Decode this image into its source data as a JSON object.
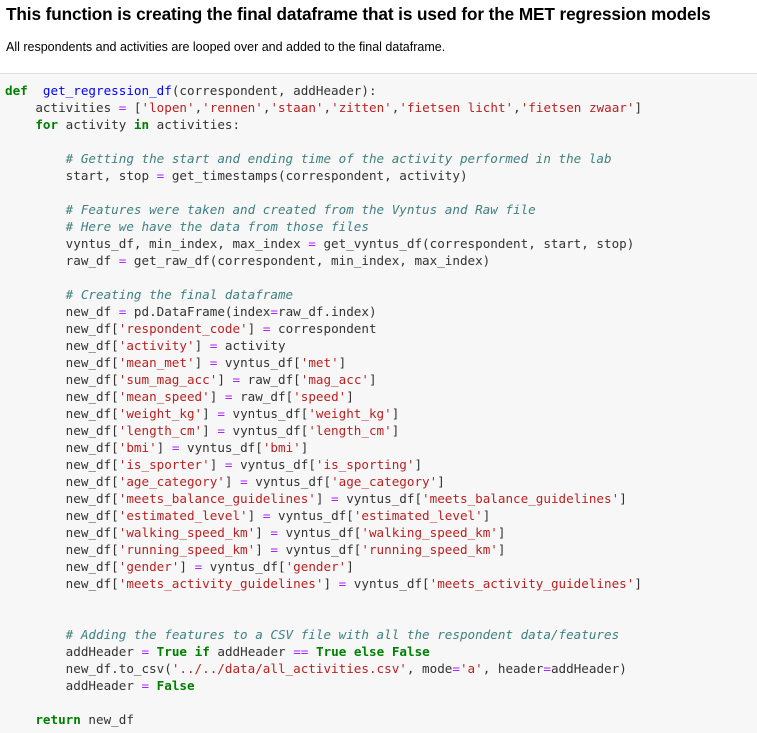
{
  "markdown": {
    "title": "This function is creating the final dataframe that is used for the MET regression models",
    "description": "All respondents and activities are looped over and added to the final dataframe."
  },
  "code_cell": {
    "lines": [
      [
        [
          "kw",
          "def"
        ],
        [
          "",
          "  "
        ],
        [
          "fn",
          "get_regression_df"
        ],
        [
          "",
          "(correspondent, addHeader):"
        ]
      ],
      [
        [
          "",
          "    activities "
        ],
        [
          "op",
          "="
        ],
        [
          "",
          " ["
        ],
        [
          "str",
          "'lopen'"
        ],
        [
          "",
          ","
        ],
        [
          "str",
          "'rennen'"
        ],
        [
          "",
          ","
        ],
        [
          "str",
          "'staan'"
        ],
        [
          "",
          ","
        ],
        [
          "str",
          "'zitten'"
        ],
        [
          "",
          ","
        ],
        [
          "str",
          "'fietsen licht'"
        ],
        [
          "",
          ","
        ],
        [
          "str",
          "'fietsen zwaar'"
        ],
        [
          "",
          "]"
        ]
      ],
      [
        [
          "",
          "    "
        ],
        [
          "kw",
          "for"
        ],
        [
          "",
          " activity "
        ],
        [
          "kw",
          "in"
        ],
        [
          "",
          " activities:"
        ]
      ],
      [
        [
          "",
          ""
        ]
      ],
      [
        [
          "",
          "        "
        ],
        [
          "cm",
          "# Getting the start and ending time of the activity performed in the lab"
        ]
      ],
      [
        [
          "",
          "        start, stop "
        ],
        [
          "op",
          "="
        ],
        [
          "",
          " get_timestamps(correspondent, activity)"
        ]
      ],
      [
        [
          "",
          ""
        ]
      ],
      [
        [
          "",
          "        "
        ],
        [
          "cm",
          "# Features were taken and created from the Vyntus and Raw file"
        ]
      ],
      [
        [
          "",
          "        "
        ],
        [
          "cm",
          "# Here we have the data from those files"
        ]
      ],
      [
        [
          "",
          "        vyntus_df, min_index, max_index "
        ],
        [
          "op",
          "="
        ],
        [
          "",
          " get_vyntus_df(correspondent, start, stop)"
        ]
      ],
      [
        [
          "",
          "        raw_df "
        ],
        [
          "op",
          "="
        ],
        [
          "",
          " get_raw_df(correspondent, min_index, max_index)"
        ]
      ],
      [
        [
          "",
          ""
        ]
      ],
      [
        [
          "",
          "        "
        ],
        [
          "cm",
          "# Creating the final dataframe"
        ]
      ],
      [
        [
          "",
          "        new_df "
        ],
        [
          "op",
          "="
        ],
        [
          "",
          " pd.DataFrame(index"
        ],
        [
          "op",
          "="
        ],
        [
          "",
          "raw_df.index)"
        ]
      ],
      [
        [
          "",
          "        new_df["
        ],
        [
          "str",
          "'respondent_code'"
        ],
        [
          "",
          "] "
        ],
        [
          "op",
          "="
        ],
        [
          "",
          " correspondent"
        ]
      ],
      [
        [
          "",
          "        new_df["
        ],
        [
          "str",
          "'activity'"
        ],
        [
          "",
          "] "
        ],
        [
          "op",
          "="
        ],
        [
          "",
          " activity"
        ]
      ],
      [
        [
          "",
          "        new_df["
        ],
        [
          "str",
          "'mean_met'"
        ],
        [
          "",
          "] "
        ],
        [
          "op",
          "="
        ],
        [
          "",
          " vyntus_df["
        ],
        [
          "str",
          "'met'"
        ],
        [
          "",
          "]"
        ]
      ],
      [
        [
          "",
          "        new_df["
        ],
        [
          "str",
          "'sum_mag_acc'"
        ],
        [
          "",
          "] "
        ],
        [
          "op",
          "="
        ],
        [
          "",
          " raw_df["
        ],
        [
          "str",
          "'mag_acc'"
        ],
        [
          "",
          "]"
        ]
      ],
      [
        [
          "",
          "        new_df["
        ],
        [
          "str",
          "'mean_speed'"
        ],
        [
          "",
          "] "
        ],
        [
          "op",
          "="
        ],
        [
          "",
          " raw_df["
        ],
        [
          "str",
          "'speed'"
        ],
        [
          "",
          "]"
        ]
      ],
      [
        [
          "",
          "        new_df["
        ],
        [
          "str",
          "'weight_kg'"
        ],
        [
          "",
          "] "
        ],
        [
          "op",
          "="
        ],
        [
          "",
          " vyntus_df["
        ],
        [
          "str",
          "'weight_kg'"
        ],
        [
          "",
          "]"
        ]
      ],
      [
        [
          "",
          "        new_df["
        ],
        [
          "str",
          "'length_cm'"
        ],
        [
          "",
          "] "
        ],
        [
          "op",
          "="
        ],
        [
          "",
          " vyntus_df["
        ],
        [
          "str",
          "'length_cm'"
        ],
        [
          "",
          "]"
        ]
      ],
      [
        [
          "",
          "        new_df["
        ],
        [
          "str",
          "'bmi'"
        ],
        [
          "",
          "] "
        ],
        [
          "op",
          "="
        ],
        [
          "",
          " vyntus_df["
        ],
        [
          "str",
          "'bmi'"
        ],
        [
          "",
          "]"
        ]
      ],
      [
        [
          "",
          "        new_df["
        ],
        [
          "str",
          "'is_sporter'"
        ],
        [
          "",
          "] "
        ],
        [
          "op",
          "="
        ],
        [
          "",
          " vyntus_df["
        ],
        [
          "str",
          "'is_sporting'"
        ],
        [
          "",
          "]"
        ]
      ],
      [
        [
          "",
          "        new_df["
        ],
        [
          "str",
          "'age_category'"
        ],
        [
          "",
          "] "
        ],
        [
          "op",
          "="
        ],
        [
          "",
          " vyntus_df["
        ],
        [
          "str",
          "'age_category'"
        ],
        [
          "",
          "]"
        ]
      ],
      [
        [
          "",
          "        new_df["
        ],
        [
          "str",
          "'meets_balance_guidelines'"
        ],
        [
          "",
          "] "
        ],
        [
          "op",
          "="
        ],
        [
          "",
          " vyntus_df["
        ],
        [
          "str",
          "'meets_balance_guidelines'"
        ],
        [
          "",
          "]"
        ]
      ],
      [
        [
          "",
          "        new_df["
        ],
        [
          "str",
          "'estimated_level'"
        ],
        [
          "",
          "] "
        ],
        [
          "op",
          "="
        ],
        [
          "",
          " vyntus_df["
        ],
        [
          "str",
          "'estimated_level'"
        ],
        [
          "",
          "]"
        ]
      ],
      [
        [
          "",
          "        new_df["
        ],
        [
          "str",
          "'walking_speed_km'"
        ],
        [
          "",
          "] "
        ],
        [
          "op",
          "="
        ],
        [
          "",
          " vyntus_df["
        ],
        [
          "str",
          "'walking_speed_km'"
        ],
        [
          "",
          "]"
        ]
      ],
      [
        [
          "",
          "        new_df["
        ],
        [
          "str",
          "'running_speed_km'"
        ],
        [
          "",
          "] "
        ],
        [
          "op",
          "="
        ],
        [
          "",
          " vyntus_df["
        ],
        [
          "str",
          "'running_speed_km'"
        ],
        [
          "",
          "]"
        ]
      ],
      [
        [
          "",
          "        new_df["
        ],
        [
          "str",
          "'gender'"
        ],
        [
          "",
          "] "
        ],
        [
          "op",
          "="
        ],
        [
          "",
          " vyntus_df["
        ],
        [
          "str",
          "'gender'"
        ],
        [
          "",
          "]"
        ]
      ],
      [
        [
          "",
          "        new_df["
        ],
        [
          "str",
          "'meets_activity_guidelines'"
        ],
        [
          "",
          "] "
        ],
        [
          "op",
          "="
        ],
        [
          "",
          " vyntus_df["
        ],
        [
          "str",
          "'meets_activity_guidelines'"
        ],
        [
          "",
          "]"
        ]
      ],
      [
        [
          "",
          ""
        ]
      ],
      [
        [
          "",
          ""
        ]
      ],
      [
        [
          "",
          "        "
        ],
        [
          "cm",
          "# Adding the features to a CSV file with all the respondent data/features"
        ]
      ],
      [
        [
          "",
          "        addHeader "
        ],
        [
          "op",
          "="
        ],
        [
          "",
          " "
        ],
        [
          "kw",
          "True"
        ],
        [
          "",
          " "
        ],
        [
          "kw",
          "if"
        ],
        [
          "",
          " addHeader "
        ],
        [
          "op",
          "=="
        ],
        [
          "",
          " "
        ],
        [
          "kw",
          "True"
        ],
        [
          "",
          " "
        ],
        [
          "kw",
          "else"
        ],
        [
          "",
          " "
        ],
        [
          "kw",
          "False"
        ]
      ],
      [
        [
          "",
          "        new_df.to_csv("
        ],
        [
          "str",
          "'../../data/all_activities.csv'"
        ],
        [
          "",
          ", mode"
        ],
        [
          "op",
          "="
        ],
        [
          "str",
          "'a'"
        ],
        [
          "",
          ", header"
        ],
        [
          "op",
          "="
        ],
        [
          "",
          "addHeader)"
        ]
      ],
      [
        [
          "",
          "        addHeader "
        ],
        [
          "op",
          "="
        ],
        [
          "",
          " "
        ],
        [
          "kw",
          "False"
        ]
      ],
      [
        [
          "",
          ""
        ]
      ],
      [
        [
          "",
          "    "
        ],
        [
          "kw",
          "return"
        ],
        [
          "",
          " new_df"
        ]
      ]
    ]
  }
}
